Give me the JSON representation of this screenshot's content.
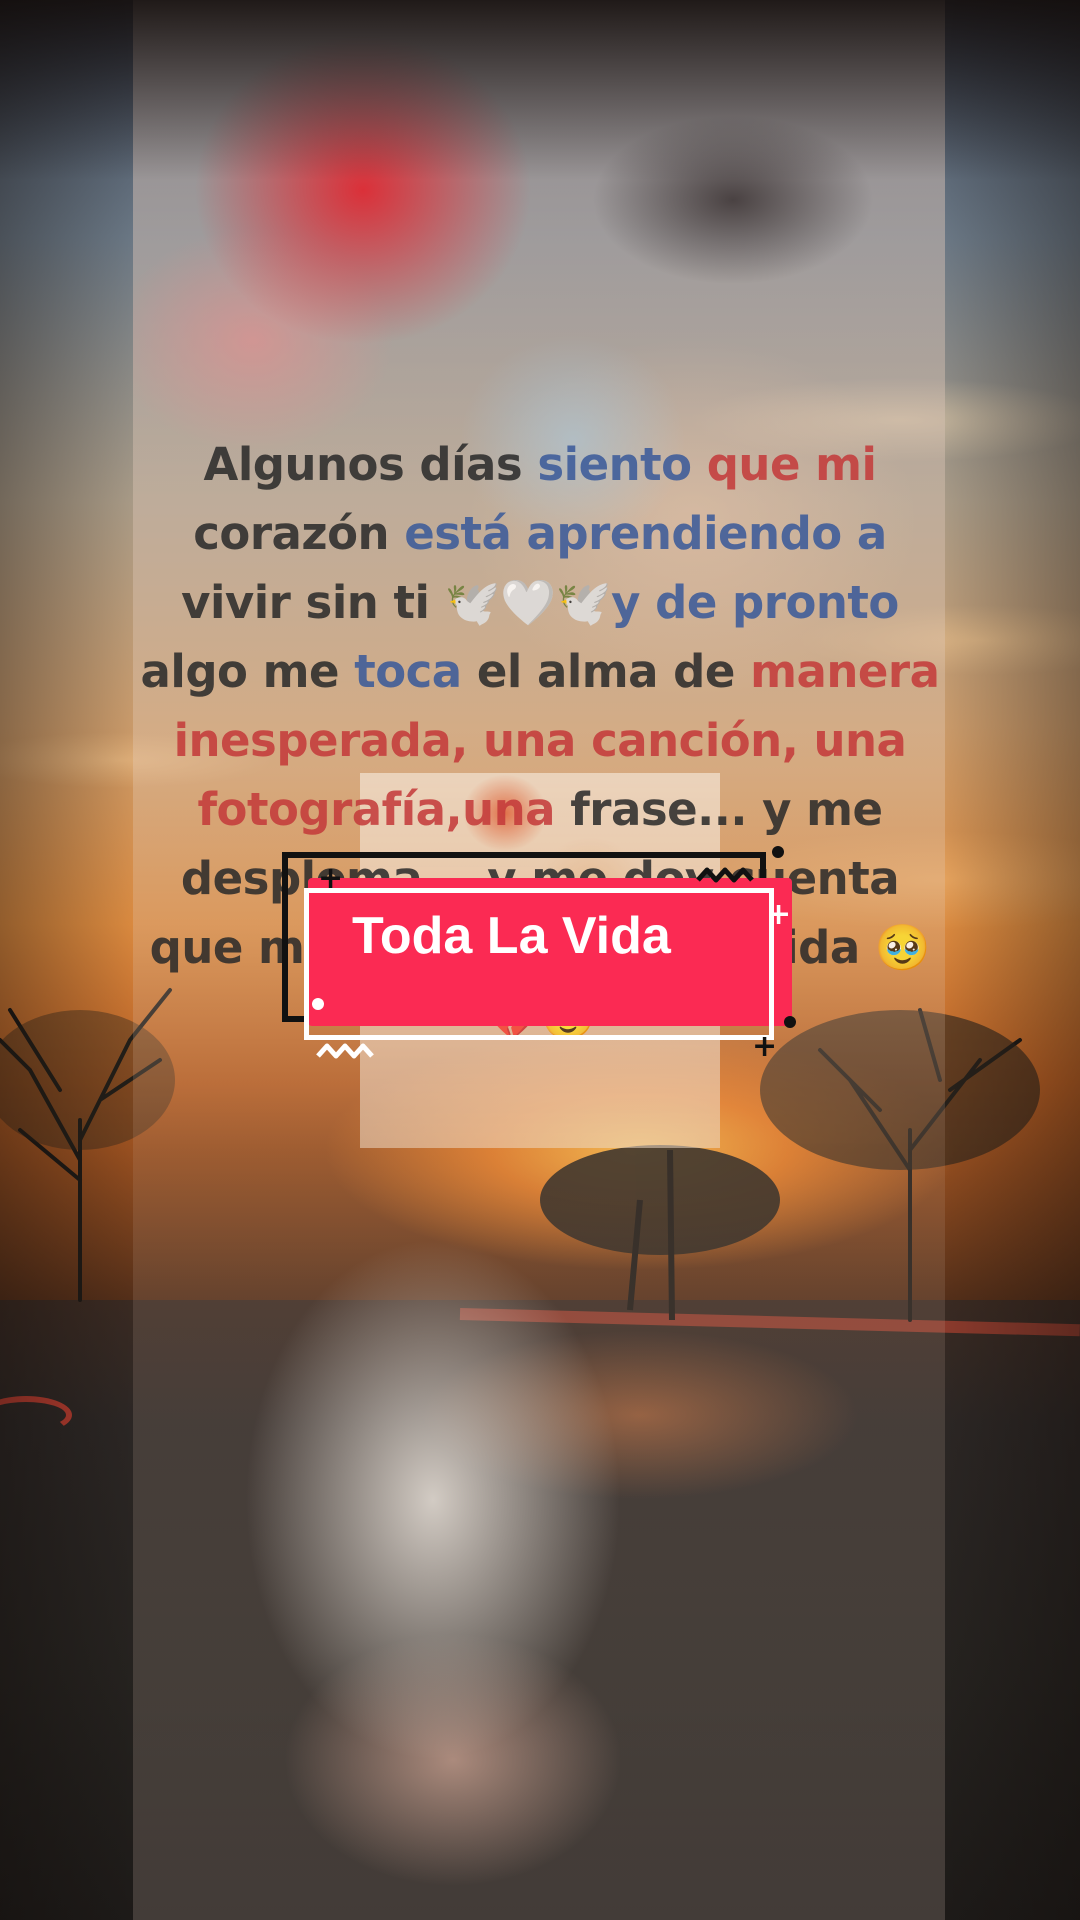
{
  "video": {
    "caption_segments": [
      {
        "text": "Algunos días ",
        "color": "#2a2a2a"
      },
      {
        "text": "siento ",
        "color": "#3a5a9a"
      },
      {
        "text": "que mi ",
        "color": "#c43a3a"
      },
      {
        "text": "corazón ",
        "color": "#2a2a2a"
      },
      {
        "text": "está aprendiendo a ",
        "color": "#3a5a9a"
      },
      {
        "text": "vivir sin ti 🕊️🤍🕊️",
        "color": "#2a2a2a"
      },
      {
        "text": "y de pronto ",
        "color": "#3a5a9a"
      },
      {
        "text": "algo me ",
        "color": "#2a2a2a"
      },
      {
        "text": "toca ",
        "color": "#3a5a9a"
      },
      {
        "text": "el alma de ",
        "color": "#2a2a2a"
      },
      {
        "text": "manera inesperada, una ",
        "color": "#c43a3a"
      },
      {
        "text": "canción, una fotografía,una ",
        "color": "#c43a3a"
      },
      {
        "text": "frase... y me ",
        "color": "#2a2a2a"
      },
      {
        "text": "desploma... ",
        "color": "#2a2a2a"
      },
      {
        "text": "y me doy ",
        "color": "#2a2a2a"
      },
      {
        "text": "cuenta que me dolerás toda ",
        "color": "#2a2a2a"
      },
      {
        "text": "mi vida 🥹💔🥹",
        "color": "#2a2a2a"
      }
    ],
    "title_badge": {
      "label": "Toda La Vida",
      "color": "#fb2a53"
    },
    "icons": [
      "plus-icon",
      "zigzag-icon",
      "dot-icon"
    ]
  }
}
